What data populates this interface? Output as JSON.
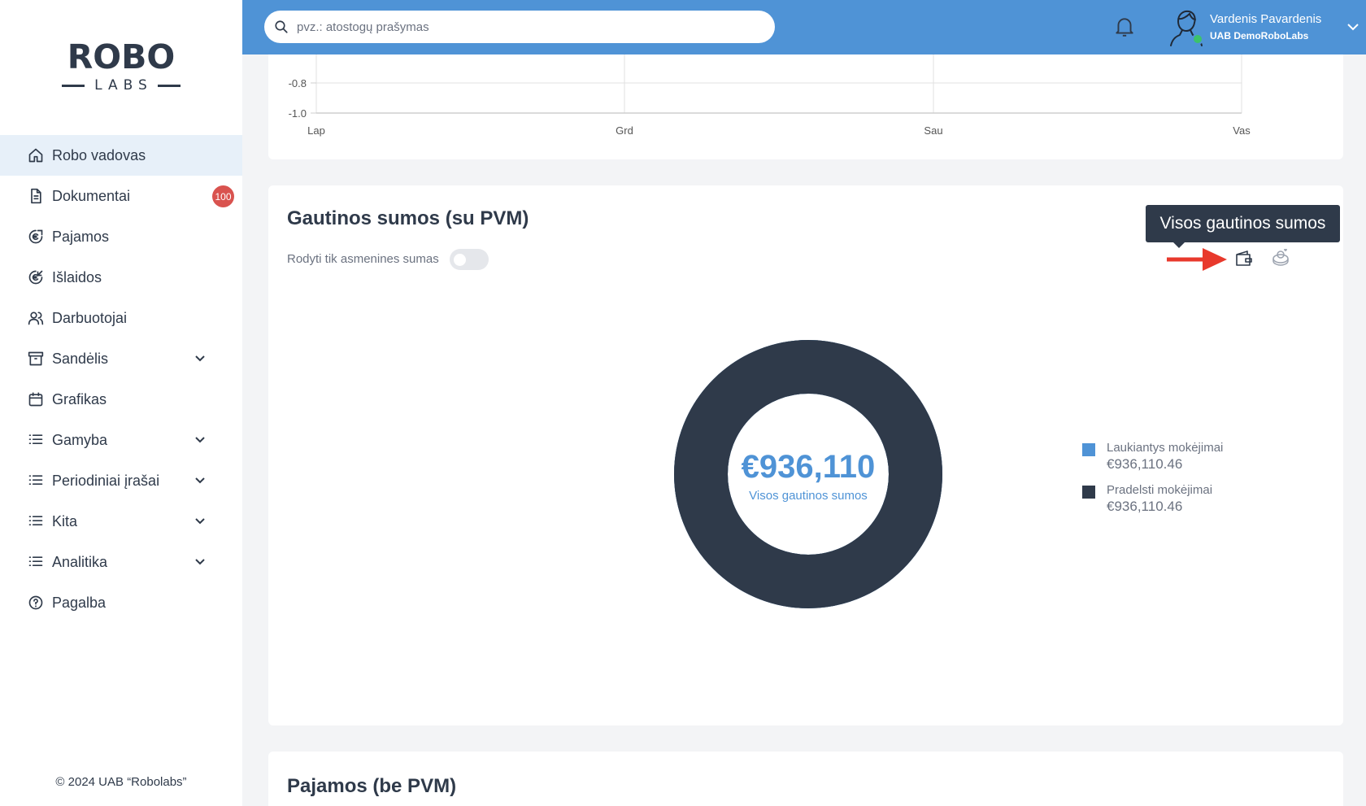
{
  "sidebar": {
    "logo_word": "ROBO",
    "logo_sub": "LABS",
    "items": [
      {
        "label": "Robo vadovas",
        "icon": "home-icon",
        "active": true
      },
      {
        "label": "Dokumentai",
        "icon": "document-icon",
        "badge": "100"
      },
      {
        "label": "Pajamos",
        "icon": "euro-income-icon"
      },
      {
        "label": "Išlaidos",
        "icon": "euro-expense-icon"
      },
      {
        "label": "Darbuotojai",
        "icon": "users-icon"
      },
      {
        "label": "Sandėlis",
        "icon": "archive-icon",
        "expandable": true
      },
      {
        "label": "Grafikas",
        "icon": "calendar-icon"
      },
      {
        "label": "Gamyba",
        "icon": "list-icon",
        "expandable": true
      },
      {
        "label": "Periodiniai įrašai",
        "icon": "list-icon",
        "expandable": true
      },
      {
        "label": "Kita",
        "icon": "list-icon",
        "expandable": true
      },
      {
        "label": "Analitika",
        "icon": "list-icon",
        "expandable": true
      },
      {
        "label": "Pagalba",
        "icon": "help-icon"
      }
    ],
    "copyright": "© 2024 UAB “Robolabs”"
  },
  "header": {
    "search_placeholder": "pvz.: atostogų prašymas",
    "user_name": "Vardenis Pavardenis",
    "company": "UAB DemoRoboLabs"
  },
  "top_chart": {
    "y_ticks": [
      "-0.8",
      "-1.0"
    ],
    "x_ticks": [
      "Lap",
      "Grd",
      "Sau",
      "Vas"
    ]
  },
  "received": {
    "title": "Gautinos sumos (su PVM)",
    "toggle_label": "Rodyti tik asmenines sumas",
    "toggle_on": false,
    "tooltip": "Visos gautinos sumos",
    "colors": {
      "pending": "#4f93d6",
      "overdue": "#2f3a4a",
      "arrow": "#e8392c"
    }
  },
  "chart_data": {
    "type": "pie",
    "center_value": "€936,110",
    "center_label": "Visos gautinos sumos",
    "series": [
      {
        "name": "Laukiantys mokėjimai",
        "value_label": "€936,110.46",
        "value": 936110.46,
        "color": "#4f93d6"
      },
      {
        "name": "Pradelsti mokėjimai",
        "value_label": "€936,110.46",
        "value": 936110.46,
        "color": "#2f3a4a"
      }
    ],
    "legend": "right"
  },
  "income": {
    "title": "Pajamos (be PVM)"
  }
}
